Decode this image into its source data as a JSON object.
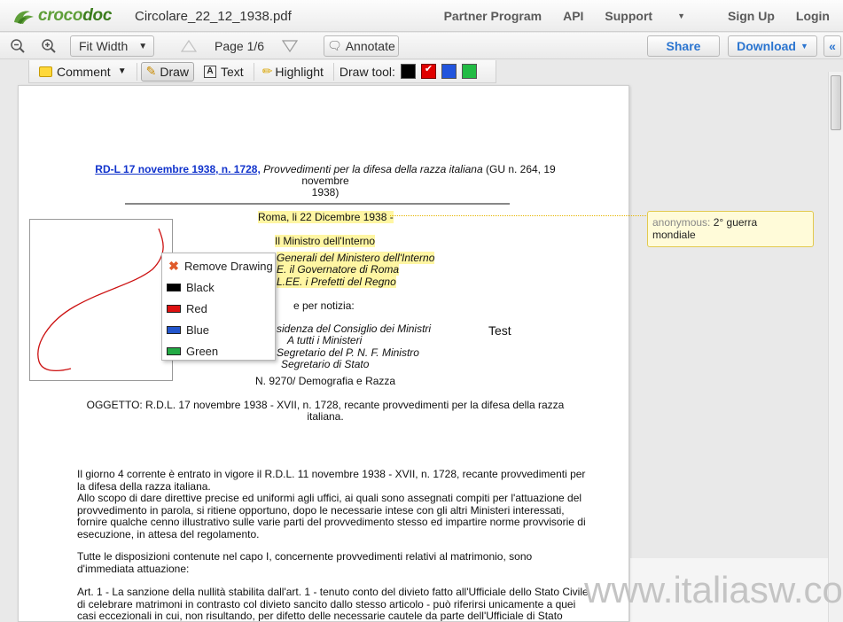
{
  "app": {
    "logo_part1": "croco",
    "logo_part2": "doc",
    "filename": "Circolare_22_12_1938.pdf",
    "nav": [
      "Partner Program",
      "API",
      "Support",
      "Sign Up",
      "Login"
    ]
  },
  "viewer": {
    "zoom_label": "Fit Width",
    "page_label": "Page 1/6",
    "annotate_label": "Annotate",
    "share_label": "Share",
    "download_label": "Download",
    "collapse_label": "«"
  },
  "annotate_toolbar": {
    "comment_label": "Comment",
    "draw_label": "Draw",
    "text_label": "Text",
    "highlight_label": "Highlight",
    "drawtool_label": "Draw tool:",
    "colors": [
      "#000000",
      "#e00000",
      "#2255dd",
      "#22bb44"
    ],
    "selected_color": "#e00000"
  },
  "document": {
    "header_link": "RD-L 17 novembre 1938, n. 1728,",
    "header_title": "Provvedimenti per la difesa della razza italiana",
    "header_gu": "(GU n. 264, 19 novembre",
    "header_gu2": "1938)",
    "date_line": "Roma, li 22 Dicembre 1938 -",
    "minister": "Il Ministro dell'Interno",
    "recip1": "Generali del Ministero dell'Interno",
    "recip2": "E. il Governatore di Roma",
    "recip3": "L.EE. i Prefetti del Regno",
    "per_notizia": "e per notizia:",
    "cc1": "sidenza del Consiglio dei Ministri",
    "cc2": "A tutti i Ministeri",
    "cc3": "Segretario del P. N. F. Ministro",
    "cc4": "Segretario di Stato",
    "protocol": "N. 9270/ Demografia e Razza",
    "subject1": "OGGETTO: R.D.L. 17 novembre 1938 - XVII, n. 1728, recante provvedimenti per la difesa della razza",
    "subject2": "italiana.",
    "p1": [
      "Il giorno 4 corrente è entrato in vigore il R.D.L. 11 novembre 1938 - XVII, n. 1728, recante provvedimenti per",
      "la difesa della razza italiana.",
      "Allo scopo di dare direttive precise ed uniformi agli uffici, ai quali sono assegnati compiti per l'attuazione del",
      "provvedimento in parola, si ritiene opportuno, dopo le necessarie intese con gli altri Ministeri interessati,",
      "fornire qualche cenno illustrativo sulle varie parti del provvedimento stesso ed impartire norme provvisorie di",
      "esecuzione, in attesa del regolamento."
    ],
    "p2": [
      "Tutte le disposizioni contenute nel capo I, concernente provvedimenti relativi al matrimonio, sono",
      "d'immediata attuazione:"
    ],
    "p3": [
      "Art. 1 - La sanzione della nullità stabilita dall'art. 1 - tenuto conto del divieto fatto all'Ufficiale dello Stato Civile",
      "di celebrare matrimoni in contrasto col divieto sancito dallo stesso articolo - può riferirsi unicamente a quei",
      "casi eccezionali in cui, non risultando, per difetto delle necessarie cautele da parte dell'Ufficiale di Stato"
    ],
    "text_annotation": "Test"
  },
  "note": {
    "author": "anonymous:",
    "text_line1": "2° guerra",
    "text_line2": "mondiale"
  },
  "context_menu": {
    "remove_label": "Remove Drawing",
    "items": [
      {
        "label": "Black",
        "color": "#000000"
      },
      {
        "label": "Red",
        "color": "#dd1111"
      },
      {
        "label": "Blue",
        "color": "#2255cc"
      },
      {
        "label": "Green",
        "color": "#22aa44"
      }
    ]
  },
  "watermark": "www.italiasw.com"
}
